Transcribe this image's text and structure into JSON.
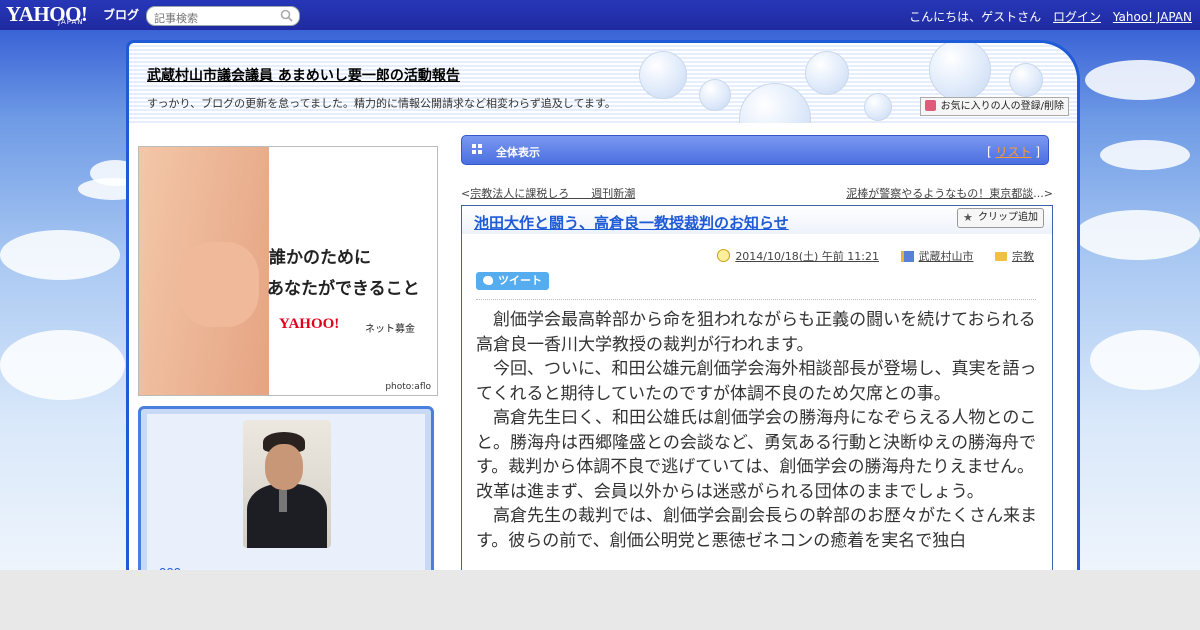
{
  "topbar": {
    "logo": "YAHOO!",
    "logo_sub": "JAPAN",
    "logo_blog": "ブログ",
    "search_placeholder": "記事検索",
    "greeting": "こんにちは、ゲストさん",
    "login": "ログイン",
    "yahoo_japan": "Yahoo! JAPAN"
  },
  "blog": {
    "title": "武蔵村山市議会議員 あまめいし要一郎の活動報告",
    "description": "すっかり、ブログの更新を怠ってました。精力的に情報公開請求など相変わらず追及してます。",
    "fav_button": "お気に入りの人の登録/削除"
  },
  "ad": {
    "line1": "誰かのために",
    "line2": "あなたができること",
    "brand": "YAHOO!",
    "brand_sub": "ネット募金",
    "photo_credit": "photo:aflo"
  },
  "profile": {
    "name": "ooo"
  },
  "main": {
    "all_view": "全体表示",
    "list_bracket_open": "[",
    "list_link": "リスト",
    "list_bracket_close": "]",
    "prev_arrow": "<",
    "prev_link": "宗教法人に課税しろ　　週刊新潮",
    "next_link": "泥棒が警察やるようなもの！東京都談",
    "next_ellipsis": "...",
    "next_arrow": ">"
  },
  "article": {
    "title": "池田大作と闘う、高倉良一教授裁判のお知らせ",
    "clip_button": "クリップ追加",
    "date": "2014/10/18(土) 午前 11:21",
    "location": "武蔵村山市",
    "category": "宗教",
    "tweet": "ツイート",
    "paragraphs": [
      "創価学会最高幹部から命を狙われながらも正義の闘いを続けておられる高倉良一香川大学教授の裁判が行われます。",
      "今回、ついに、和田公雄元創価学会海外相談部長が登場し、真実を語ってくれると期待していたのですが体調不良のため欠席との事。",
      "高倉先生曰く、和田公雄氏は創価学会の勝海舟になぞらえる人物とのこと。勝海舟は西郷隆盛との会談など、勇気ある行動と決断ゆえの勝海舟です。裁判から体調不良で逃げていては、創価学会の勝海舟たりえません。改革は進まず、会員以外からは迷惑がられる団体のままでしょう。",
      "高倉先生の裁判では、創価学会副会長らの幹部のお歴々がたくさん来ます。彼らの前で、創価公明党と悪徳ゼネコンの癒着を実名で独白"
    ]
  }
}
